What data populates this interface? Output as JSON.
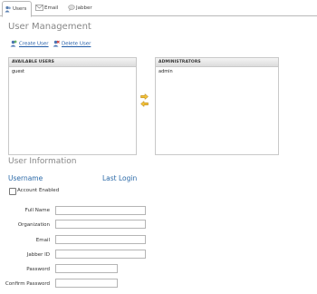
{
  "tabs": [
    {
      "label": "Users",
      "icon": "users-icon",
      "active": true
    },
    {
      "label": "Email",
      "icon": "email-icon",
      "active": false
    },
    {
      "label": "Jabber",
      "icon": "chat-bubble-icon",
      "active": false
    }
  ],
  "page_title": "User Management",
  "actions": {
    "create": "Create User",
    "delete": "Delete User"
  },
  "available_users": {
    "header": "AVAILABLE USERS",
    "items": [
      "guest"
    ]
  },
  "administrators": {
    "header": "ADMINISTRATORS",
    "items": [
      "admin"
    ]
  },
  "user_info": {
    "title": "User Information",
    "username_header": "Username",
    "last_login_header": "Last Login",
    "account_enabled_label": "Account Enabled",
    "fields": {
      "full_name": "Full Name",
      "organization": "Organization",
      "email": "Email",
      "jabber_id": "Jabber ID",
      "password": "Password",
      "confirm_password": "Confirm Password"
    }
  },
  "colors": {
    "link": "#1f5aa6",
    "accent_arrow": "#e8a317",
    "header_blue": "#2c6aa8"
  }
}
